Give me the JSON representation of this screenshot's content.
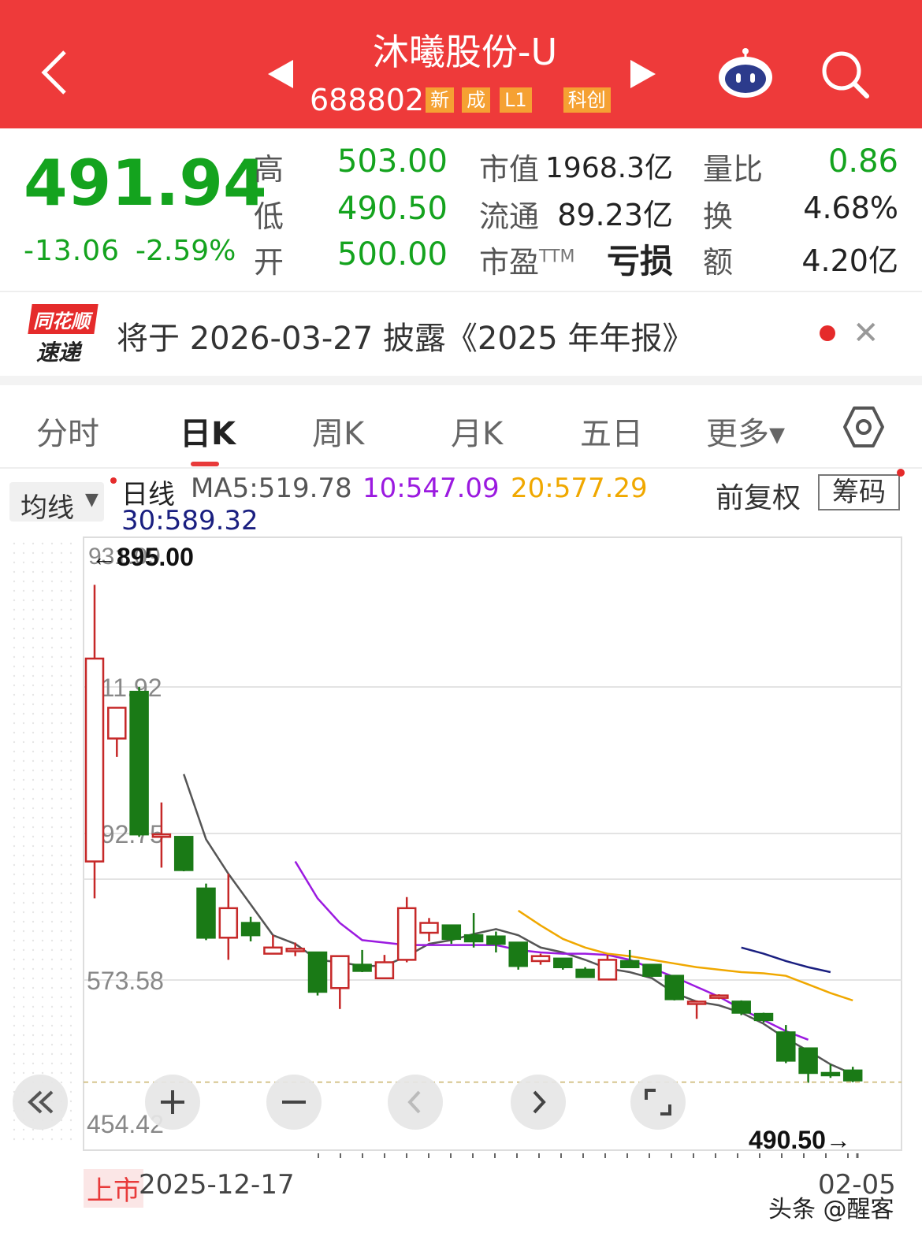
{
  "header": {
    "title": "沐曦股份-U",
    "code": "688802",
    "tags": [
      {
        "label": "新",
        "color": "#f5a133"
      },
      {
        "label": "成",
        "color": "#f5a133"
      },
      {
        "label": "L1",
        "color": "#f5a133"
      },
      {
        "label": "科创",
        "color": "#f5a133"
      }
    ],
    "icons": [
      "back-icon",
      "prev-stock-icon",
      "next-stock-icon",
      "robot-assistant-icon",
      "search-icon"
    ],
    "bg_color": "#ee3a3a"
  },
  "quote": {
    "price": "491.94",
    "change": "-13.06",
    "change_pct": "-2.59%",
    "high_label": "高",
    "high": "503.00",
    "low_label": "低",
    "low": "490.50",
    "open_label": "开",
    "open": "500.00",
    "mktcap_label": "市值",
    "mktcap": "1968.3亿",
    "float_label": "流通",
    "float": "89.23亿",
    "pe_label": "市盈",
    "pe_sup": "TTM",
    "pe": "亏损",
    "vol_ratio_label": "量比",
    "vol_ratio": "0.86",
    "turnover_label": "换",
    "turnover": "4.68%",
    "amount_label": "额",
    "amount": "4.20亿",
    "down_color": "#14a31e"
  },
  "banner": {
    "logo_top": "同花顺",
    "logo_bottom": "速递",
    "text": "将于 2026-03-27 披露《2025 年年报》"
  },
  "tabs": [
    {
      "label": "分时",
      "active": false
    },
    {
      "label": "日K",
      "active": true
    },
    {
      "label": "周K",
      "active": false
    },
    {
      "label": "月K",
      "active": false
    },
    {
      "label": "五日",
      "active": false
    },
    {
      "label": "更多▾",
      "active": false
    }
  ],
  "ma_bar": {
    "selector": "均线",
    "kline": "日线",
    "ma5": "MA5:519.78",
    "ma10": "10:547.09",
    "ma20": "20:577.29",
    "ma30": "30:589.32",
    "adjust": "前复权",
    "chips": "筹码",
    "ma5_color": "#555555",
    "ma10_color": "#9b1ae0",
    "ma20_color": "#f0a800",
    "ma30_color": "#1a1f80"
  },
  "chart_data": {
    "type": "candlestick",
    "y_ticks": [
      "811.92",
      "692.75",
      "573.58",
      "454.42"
    ],
    "top_label": "931.09",
    "max_marker": "←895.00",
    "min_marker": "490.50→",
    "start_label": "上市",
    "start_date": "2025-12-17",
    "end_date": "02-05",
    "ylim": [
      454.42,
      931.09
    ],
    "candles": [
      {
        "o": 670,
        "h": 895,
        "l": 640,
        "c": 835
      },
      {
        "o": 770,
        "h": 795,
        "l": 755,
        "c": 795
      },
      {
        "o": 808,
        "h": 812,
        "l": 690,
        "c": 692
      },
      {
        "o": 690,
        "h": 718,
        "l": 665,
        "c": 692
      },
      {
        "o": 690,
        "h": 690,
        "l": 662,
        "c": 663
      },
      {
        "o": 648,
        "h": 652,
        "l": 606,
        "c": 608
      },
      {
        "o": 608,
        "h": 660,
        "l": 590,
        "c": 632
      },
      {
        "o": 620,
        "h": 625,
        "l": 605,
        "c": 610
      },
      {
        "o": 595,
        "h": 610,
        "l": 595,
        "c": 600
      },
      {
        "o": 597,
        "h": 604,
        "l": 593,
        "c": 599
      },
      {
        "o": 596,
        "h": 596,
        "l": 561,
        "c": 564
      },
      {
        "o": 567,
        "h": 590,
        "l": 550,
        "c": 593
      },
      {
        "o": 586,
        "h": 598,
        "l": 580,
        "c": 581
      },
      {
        "o": 575,
        "h": 594,
        "l": 575,
        "c": 588
      },
      {
        "o": 590,
        "h": 641,
        "l": 588,
        "c": 632
      },
      {
        "o": 612,
        "h": 624,
        "l": 605,
        "c": 620
      },
      {
        "o": 618,
        "h": 618,
        "l": 603,
        "c": 607
      },
      {
        "o": 610,
        "h": 628,
        "l": 600,
        "c": 605
      },
      {
        "o": 609,
        "h": 613,
        "l": 596,
        "c": 603
      },
      {
        "o": 604,
        "h": 604,
        "l": 582,
        "c": 585
      },
      {
        "o": 589,
        "h": 595,
        "l": 586,
        "c": 593
      },
      {
        "o": 591,
        "h": 591,
        "l": 582,
        "c": 584
      },
      {
        "o": 582,
        "h": 584,
        "l": 576,
        "c": 576
      },
      {
        "o": 574,
        "h": 594,
        "l": 574,
        "c": 590
      },
      {
        "o": 589,
        "h": 598,
        "l": 586,
        "c": 584
      },
      {
        "o": 586,
        "h": 586,
        "l": 576,
        "c": 577
      },
      {
        "o": 577,
        "h": 577,
        "l": 557,
        "c": 558
      },
      {
        "o": 556,
        "h": 557,
        "l": 542,
        "c": 556
      },
      {
        "o": 560,
        "h": 562,
        "l": 558,
        "c": 561
      },
      {
        "o": 556,
        "h": 557,
        "l": 545,
        "c": 547
      },
      {
        "o": 546,
        "h": 547,
        "l": 539,
        "c": 541
      },
      {
        "o": 531,
        "h": 537,
        "l": 506,
        "c": 508
      },
      {
        "o": 518,
        "h": 518,
        "l": 490,
        "c": 498
      },
      {
        "o": 498,
        "h": 505,
        "l": 494,
        "c": 497
      },
      {
        "o": 500,
        "h": 503,
        "l": 490.5,
        "c": 491.94
      }
    ],
    "ma5": [
      null,
      null,
      null,
      null,
      741,
      688,
      660,
      635,
      610,
      603,
      590,
      588,
      585,
      585,
      593,
      603,
      606,
      611,
      615,
      610,
      600,
      596,
      590,
      583,
      580,
      575,
      563,
      556,
      553,
      547,
      538,
      526,
      516,
      505,
      497
    ],
    "ma10": [
      null,
      null,
      null,
      null,
      null,
      null,
      null,
      null,
      null,
      670,
      640,
      620,
      606,
      604,
      602,
      602,
      602,
      602,
      602,
      598,
      596,
      595,
      595,
      594,
      590,
      583,
      576,
      568,
      560,
      550,
      541,
      532,
      525
    ],
    "ma20": [
      null,
      null,
      null,
      null,
      null,
      null,
      null,
      null,
      null,
      null,
      null,
      null,
      null,
      null,
      null,
      null,
      null,
      null,
      null,
      630,
      618,
      607,
      600,
      595,
      593,
      590,
      587,
      584,
      582,
      580,
      579,
      577,
      570,
      563,
      557
    ],
    "ma30": [
      null,
      null,
      null,
      null,
      null,
      null,
      null,
      null,
      null,
      null,
      null,
      null,
      null,
      null,
      null,
      null,
      null,
      null,
      null,
      null,
      null,
      null,
      null,
      null,
      null,
      null,
      null,
      null,
      null,
      600,
      595,
      589,
      584,
      580
    ],
    "up_color": "#c62828",
    "down_color": "#1a7a16"
  },
  "controls": [
    "collapse-icon",
    "zoom-in-icon",
    "zoom-out-icon",
    "pan-left-icon",
    "pan-right-icon",
    "fullscreen-icon"
  ],
  "watermark": "头条 @醒客"
}
